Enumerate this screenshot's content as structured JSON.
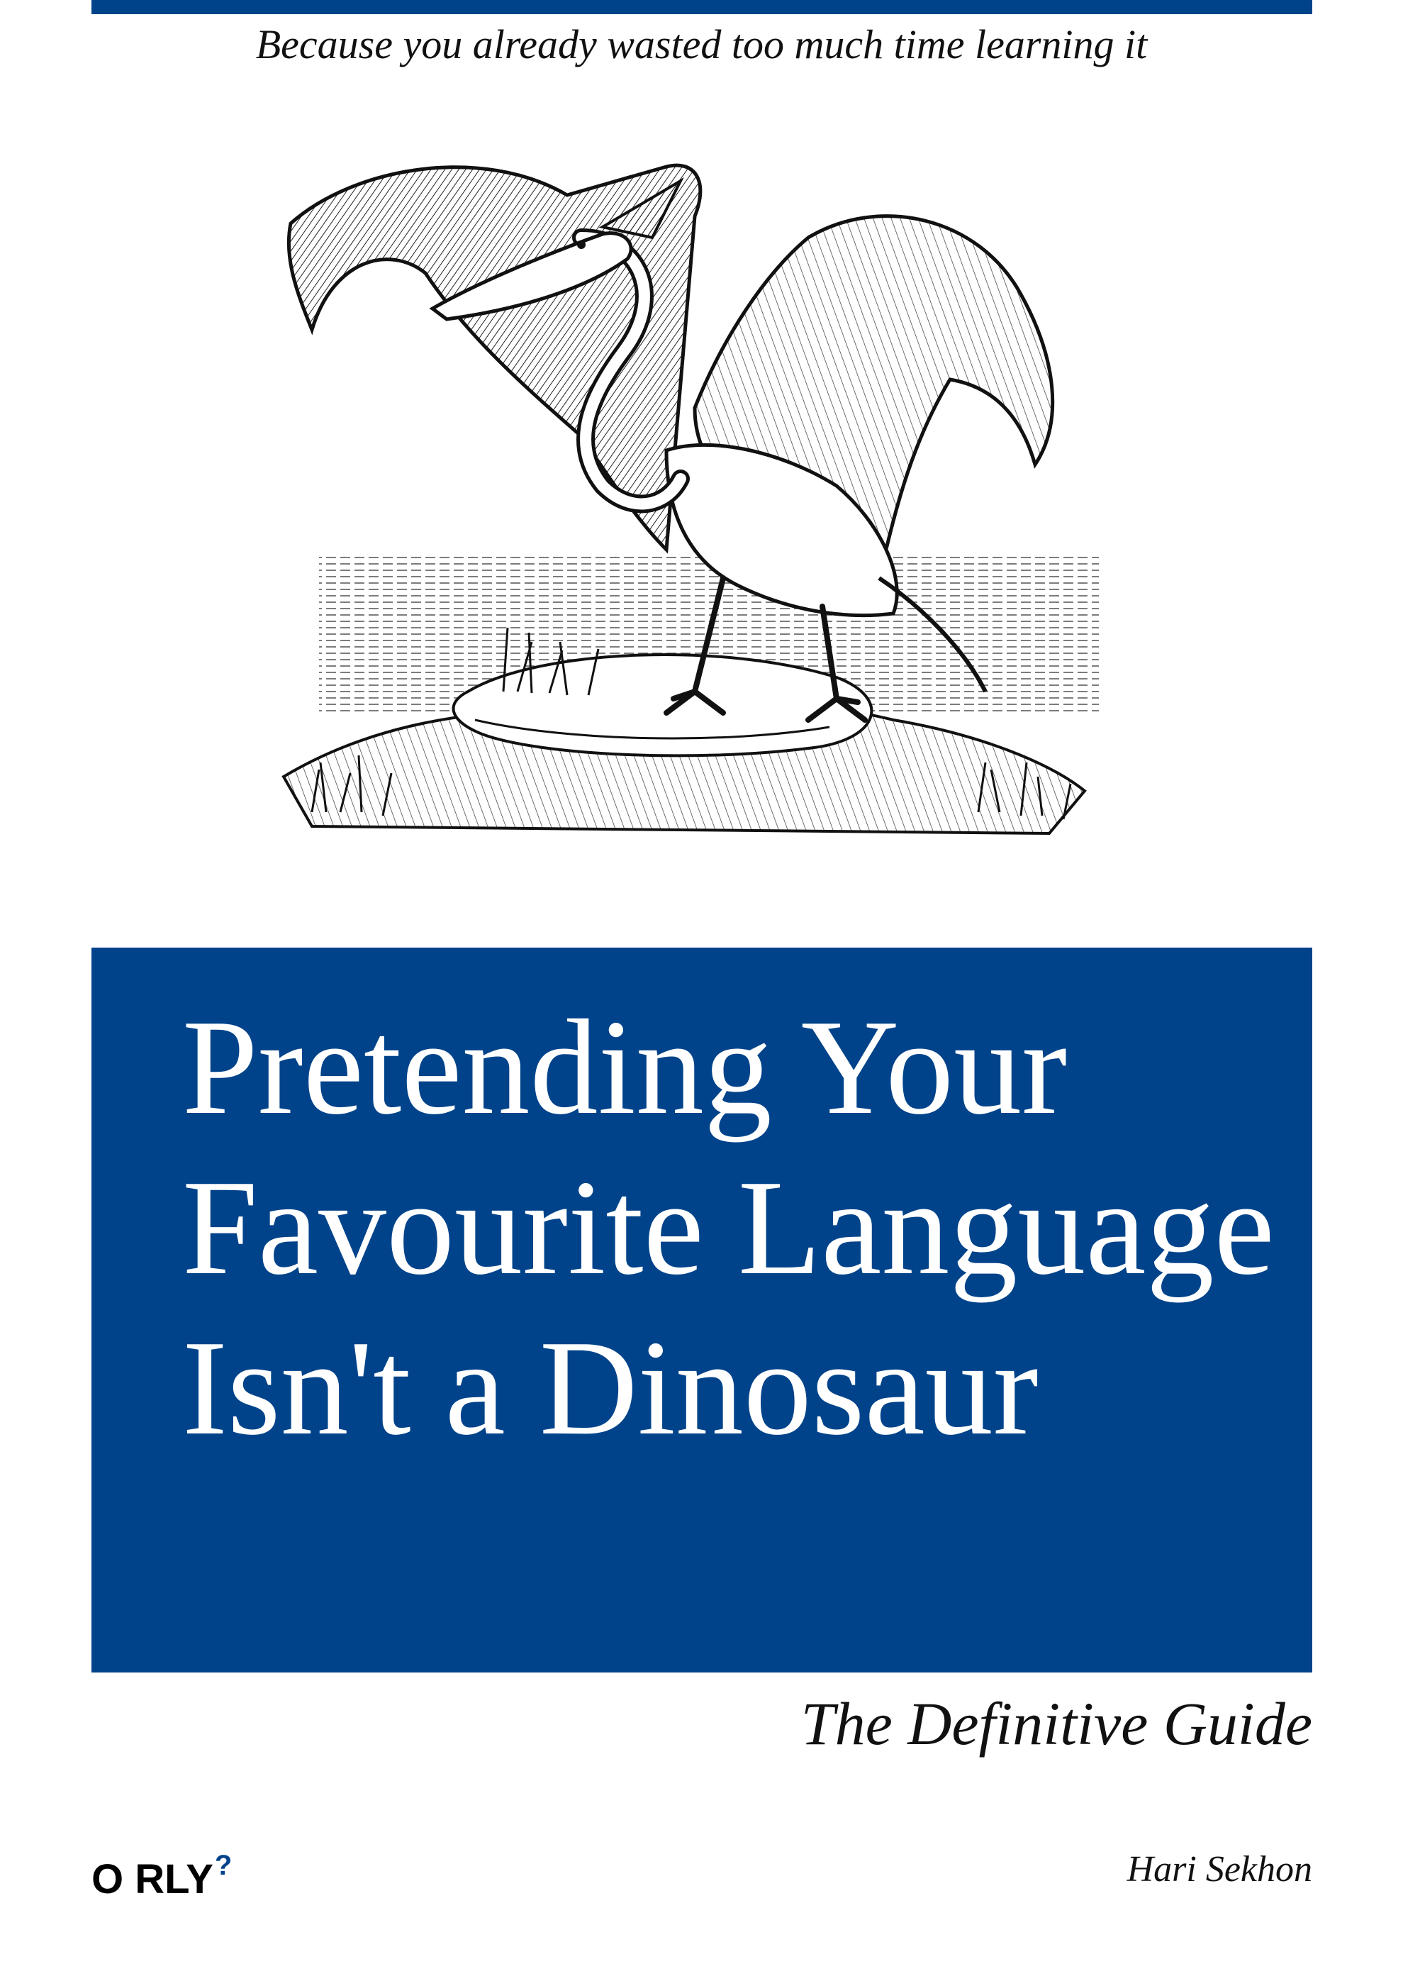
{
  "cover": {
    "accent_color": "#00438a",
    "tagline": "Because you already wasted too much time learning it",
    "title": "Pretending Your Favourite Language Isn't a Dinosaur",
    "subtitle": "The Definitive Guide",
    "publisher": {
      "name": "O RLY",
      "mark": "?"
    },
    "author": "Hari Sekhon",
    "illustration_icon": "pterodactyl-engraving"
  }
}
